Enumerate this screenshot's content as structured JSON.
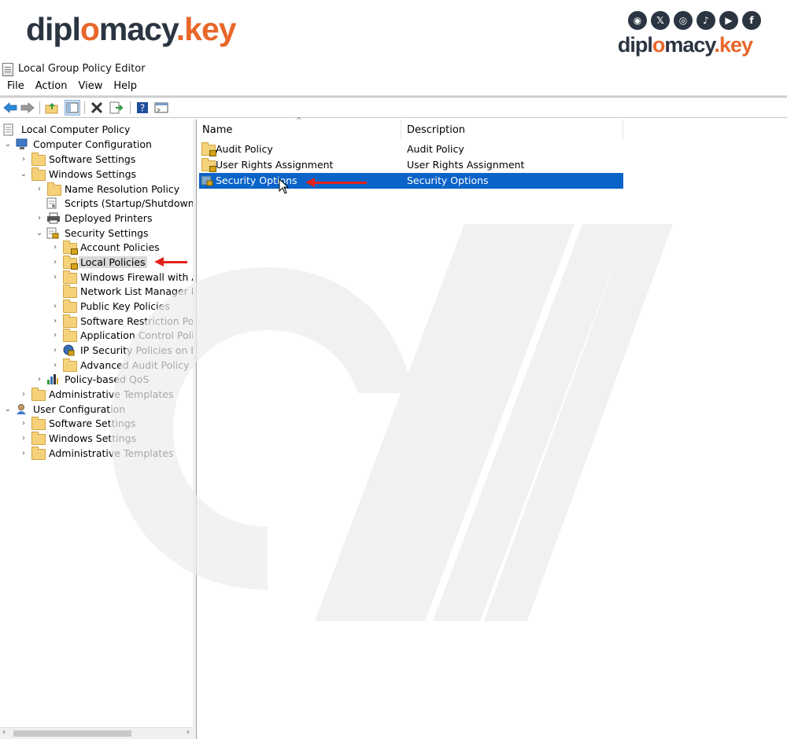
{
  "brand": {
    "word1": "dipl",
    "word1b": "macy",
    "dot": ".",
    "word2": "key"
  },
  "socials": [
    {
      "icon": "snapchat-icon",
      "glyph": "◉"
    },
    {
      "icon": "x-icon",
      "glyph": "𝕏"
    },
    {
      "icon": "instagram-icon",
      "glyph": "◎"
    },
    {
      "icon": "tiktok-icon",
      "glyph": "♪"
    },
    {
      "icon": "youtube-icon",
      "glyph": "▶"
    },
    {
      "icon": "facebook-icon",
      "glyph": "f"
    }
  ],
  "window": {
    "title": "Local Group Policy Editor"
  },
  "menu": {
    "file": "File",
    "action": "Action",
    "view": "View",
    "help": "Help"
  },
  "tree": {
    "root": "Local Computer Policy",
    "computer_config": "Computer Configuration",
    "software_settings": "Software Settings",
    "windows_settings": "Windows Settings",
    "name_resolution": "Name Resolution Policy",
    "scripts": "Scripts (Startup/Shutdown)",
    "deployed_printers": "Deployed Printers",
    "security_settings": "Security Settings",
    "account_policies": "Account Policies",
    "local_policies": "Local Policies",
    "windows_firewall": "Windows Firewall with Ac",
    "network_list": "Network List Manager Po",
    "public_key": "Public Key Policies",
    "software_restriction": "Software Restriction Polic",
    "application_control": "Application Control Polic",
    "ip_security": "IP Security Policies on Lo",
    "advanced_audit": "Advanced Audit Policy Co",
    "policy_qos": "Policy-based QoS",
    "admin_templates": "Administrative Templates",
    "user_config": "User Configuration",
    "user_software_settings": "Software Settings",
    "user_windows_settings": "Windows Settings",
    "user_admin_templates": "Administrative Templates"
  },
  "list": {
    "col_name": "Name",
    "col_desc": "Description",
    "rows": [
      {
        "name": "Audit Policy",
        "desc": "Audit Policy"
      },
      {
        "name": "User Rights Assignment",
        "desc": "User Rights Assignment"
      },
      {
        "name": "Security Options",
        "desc": "Security Options"
      }
    ]
  },
  "colors": {
    "accent_orange": "#e8672a",
    "brand_dark": "#2b3542",
    "selection_blue": "#0a63c9",
    "arrow_red": "#e2231a"
  }
}
